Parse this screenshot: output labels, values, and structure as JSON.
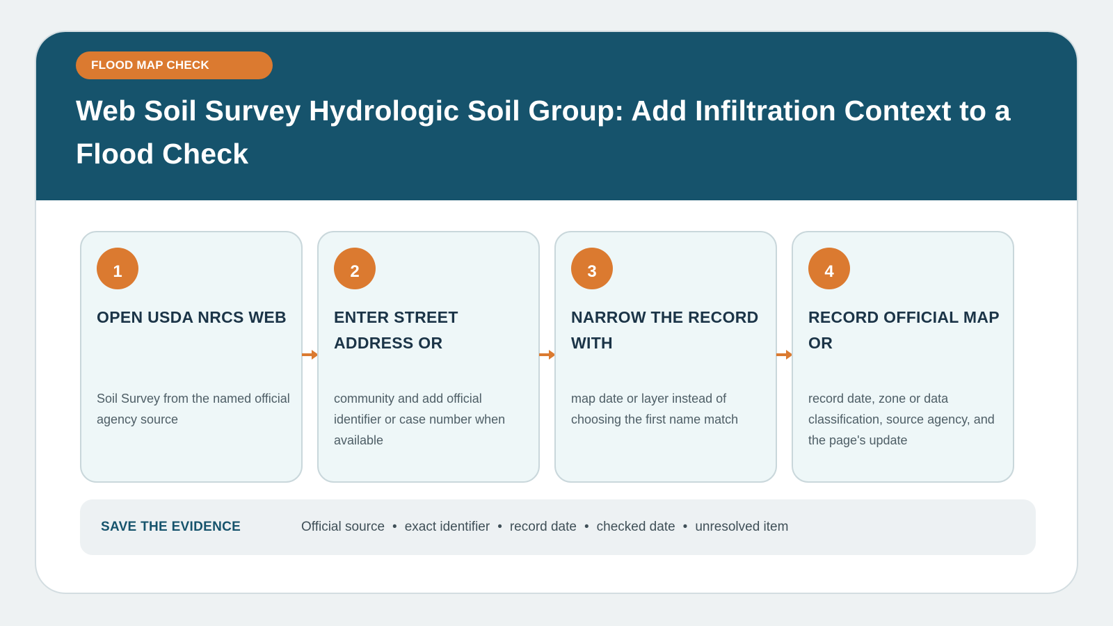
{
  "badge": "FLOOD MAP CHECK",
  "title": "Web Soil Survey Hydrologic Soil Group: Add Infiltration Context to a Flood Check",
  "steps": [
    {
      "number": "1",
      "title": "OPEN USDA NRCS WEB",
      "description": "Soil Survey from the named official agency source"
    },
    {
      "number": "2",
      "title": "ENTER STREET ADDRESS OR",
      "description": "community and add official identifier or case number when available"
    },
    {
      "number": "3",
      "title": "NARROW THE RECORD WITH",
      "description": "map date or layer instead of choosing the first name match"
    },
    {
      "number": "4",
      "title": "RECORD OFFICIAL MAP OR",
      "description": "record date, zone or data classification, source agency, and the page's update"
    }
  ],
  "evidence": {
    "label": "SAVE THE EVIDENCE",
    "items": [
      "Official source",
      "exact identifier",
      "record date",
      "checked date",
      "unresolved item"
    ],
    "separator": "•"
  },
  "colors": {
    "page_bg": "#eef2f3",
    "header_bg": "#16536c",
    "accent": "#db7a30",
    "step_bg": "#eef7f8",
    "heading_text": "#1b3447"
  },
  "icons": {
    "connector": "arrow-right-icon"
  }
}
